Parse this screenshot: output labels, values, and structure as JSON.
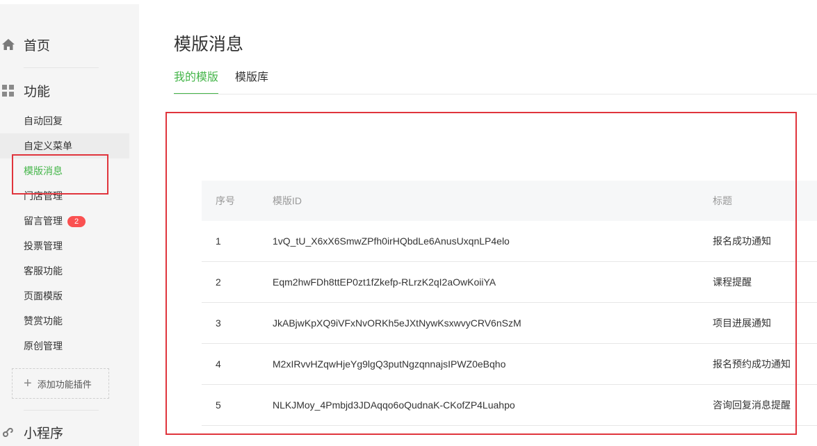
{
  "sidebar": {
    "home_label": "首页",
    "function_label": "功能",
    "items": [
      {
        "label": "自动回复"
      },
      {
        "label": "自定义菜单"
      },
      {
        "label": "模版消息"
      },
      {
        "label": "门店管理"
      },
      {
        "label": "留言管理",
        "badge": "2"
      },
      {
        "label": "投票管理"
      },
      {
        "label": "客服功能"
      },
      {
        "label": "页面模版"
      },
      {
        "label": "赞赏功能"
      },
      {
        "label": "原创管理"
      }
    ],
    "add_plugin_label": "添加功能插件",
    "miniprogram_label": "小程序"
  },
  "main": {
    "title": "模版消息",
    "tabs": [
      {
        "label": "我的模版",
        "active": true
      },
      {
        "label": "模版库",
        "active": false
      }
    ],
    "table": {
      "headers": [
        "序号",
        "模版ID",
        "标题"
      ],
      "rows": [
        [
          "1",
          "1vQ_tU_X6xX6SmwZPfh0irHQbdLe6AnusUxqnLP4elo",
          "报名成功通知"
        ],
        [
          "2",
          "Eqm2hwFDh8ttEP0zt1fZkefp-RLrzK2qI2aOwKoiiYA",
          "课程提醒"
        ],
        [
          "3",
          "JkABjwKpXQ9iVFxNvORKh5eJXtNywKsxwvyCRV6nSzM",
          "项目进展通知"
        ],
        [
          "4",
          "M2xIRvvHZqwHjeYg9lgQ3putNgzqnnajsIPWZ0eBqho",
          "报名预约成功通知"
        ],
        [
          "5",
          "NLKJMoy_4Pmbjd3JDAqqo6oQudnaK-CKofZP4Luahpo",
          "咨询回复消息提醒"
        ]
      ]
    }
  },
  "colors": {
    "accent_green": "#44b549",
    "badge_red": "#fa5151",
    "annotation_red": "#e0343c"
  },
  "icons": [
    "home-icon",
    "grid-icon",
    "plus-icon",
    "miniprogram-icon"
  ]
}
